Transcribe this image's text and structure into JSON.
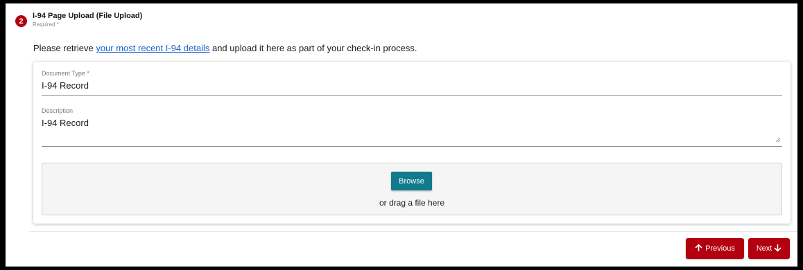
{
  "step": {
    "number": "2",
    "title": "I-94 Page Upload (File Upload)",
    "required_label": "Required *"
  },
  "instruction": {
    "prefix": "Please retrieve ",
    "link_text": "your most recent I-94 details",
    "suffix": " and upload it here as part of your check-in process."
  },
  "form": {
    "document_type_label": "Document Type *",
    "document_type_value": "I-94 Record",
    "description_label": "Description",
    "description_value": "I-94 Record"
  },
  "upload": {
    "browse_label": "Browse",
    "drag_text": "or drag a file here"
  },
  "navigation": {
    "previous_label": "Previous",
    "next_label": "Next"
  },
  "colors": {
    "accent_red": "#b3000f",
    "browse_teal": "#117a8b",
    "link_blue": "#1a63c9"
  },
  "icons": {
    "previous": "arrow-up-icon",
    "next": "arrow-down-icon",
    "resize": "resize-handle-icon"
  }
}
